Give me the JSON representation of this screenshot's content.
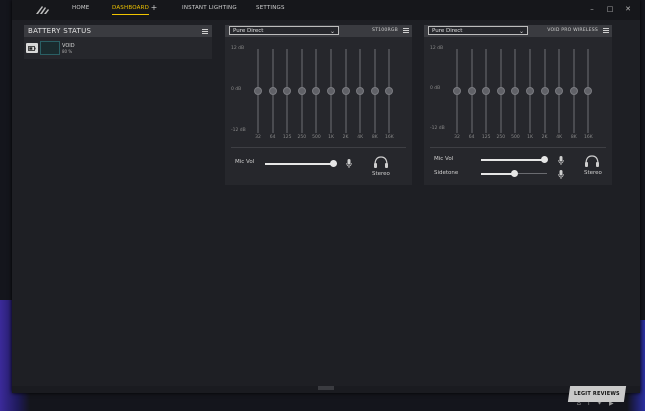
{
  "nav": {
    "home": "HOME",
    "dashboard": "DASHBOARD",
    "add": "+",
    "instant_lighting": "INSTANT LIGHTING",
    "settings": "SETTINGS"
  },
  "window": {
    "minimize": "–",
    "maximize": "□",
    "close": "✕"
  },
  "battery": {
    "title": "BATTERY STATUS",
    "device_name": "VOID",
    "device_pct": "80 %"
  },
  "eq_labels": {
    "top": "12 dB",
    "mid": "0 dB",
    "bottom": "-12 dB",
    "freqs": [
      "32",
      "64",
      "125",
      "250",
      "500",
      "1K",
      "2K",
      "4K",
      "8K",
      "16K"
    ]
  },
  "st100": {
    "preset": "Pure Direct",
    "device": "ST100RGB",
    "mic_vol_label": "Mic Vol",
    "mic_vol": 0.95,
    "stereo_label": "Stereo",
    "eq_values_db": [
      0,
      0,
      0,
      0,
      0,
      0,
      0,
      0,
      0,
      0
    ]
  },
  "void": {
    "preset": "Pure Direct",
    "device": "VOID PRO WIRELESS",
    "mic_vol_label": "Mic Vol",
    "mic_vol": 0.95,
    "sidetone_label": "Sidetone",
    "sidetone": 0.5,
    "stereo_label": "Stereo",
    "eq_values_db": [
      0,
      0,
      0,
      0,
      0,
      0,
      0,
      0,
      0,
      0
    ]
  },
  "watermark": "LEGIT REVIEWS",
  "colors": {
    "accent": "#f0c400",
    "panel": "#26272c",
    "header": "#3a3b40"
  },
  "icons": [
    "corsair-logo-icon",
    "battery-icon",
    "mic-icon",
    "headset-icon",
    "menu-icon"
  ]
}
